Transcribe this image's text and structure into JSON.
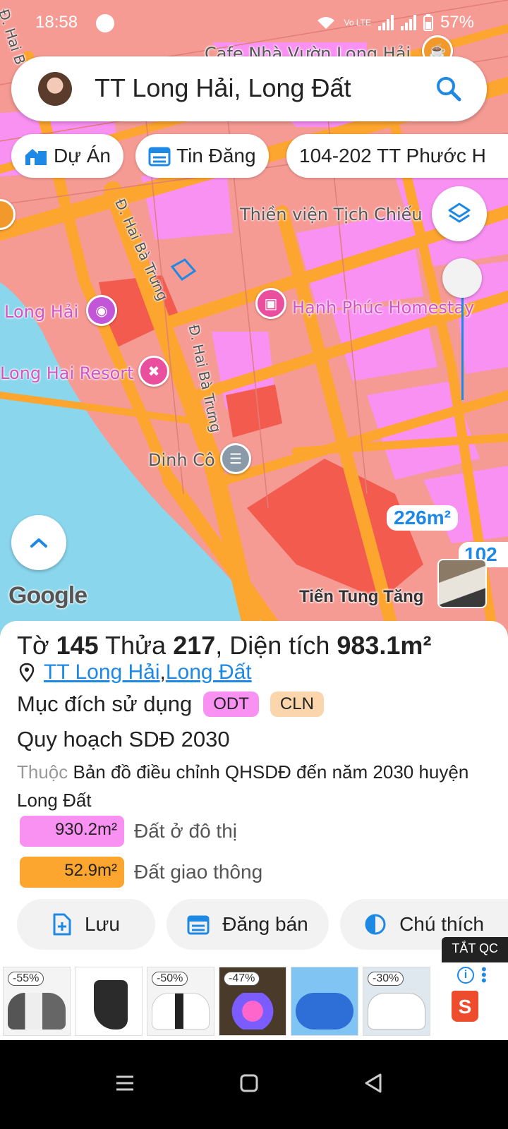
{
  "status_bar": {
    "time": "18:58",
    "network_label": "Vo LTE",
    "battery": "57%"
  },
  "search": {
    "query": "TT Long Hải, Long Đất"
  },
  "chips": [
    {
      "label": "Dự Án",
      "icon": "building-icon"
    },
    {
      "label": "Tin Đăng",
      "icon": "calendar-list-icon"
    },
    {
      "label": "104-202 TT Phước H",
      "icon": ""
    }
  ],
  "map": {
    "labels": {
      "cafe": "Cafe Nhà Vườn Long Hải",
      "hai_road_top": "Đ. Hai B",
      "thien_vien": "Thiền viện Tịch Chiếu",
      "road_1": "Đ. Hai Bà Trưng",
      "road_2": "Đ. Hai Bà Trưng",
      "long_hai": "Long Hải",
      "homestay": "Hạnh Phúc Homestay",
      "resort": "Long Hai Resort",
      "dinh_co": "Dinh Cô"
    },
    "area_badge": "226m²",
    "area_badge_2": "102",
    "google_logo": "Google",
    "streetview_label": "Tiến Tung Tăng",
    "colors": {
      "residential": "#f991f3",
      "perennial": "#f59b94",
      "road": "#fca52f",
      "water": "#8ad6ec",
      "parcel_red": "#f35b4f"
    }
  },
  "parcel": {
    "prefix_to": "Tờ ",
    "to_number": "145",
    "prefix_thua": " Thửa ",
    "thua_number": "217",
    "prefix_area": ", Diện tích ",
    "area": "983.1m²",
    "location_link_1": "TT Long Hải",
    "location_sep": ", ",
    "location_link_2": "Long Đất",
    "usage_label": "Mục đích sử dụng",
    "usage_tags": [
      "ODT",
      "CLN"
    ],
    "plan_title": "Quy hoạch SDĐ 2030",
    "plan_desc_prefix": "Thuộc",
    "plan_desc": " Bản đồ điều chỉnh QHSDĐ đến năm 2030 huyện Long Đất",
    "land_rows": [
      {
        "amount": "930.2m²",
        "label": "Đất ở đô thị",
        "color": "#f991f3"
      },
      {
        "amount": "52.9m²",
        "label": "Đất giao thông",
        "color": "#fca52f"
      }
    ]
  },
  "actions": {
    "save": "Lưu",
    "post_sale": "Đăng bán",
    "legend": "Chú thích"
  },
  "ad": {
    "close_label": "TẮT QC",
    "items": [
      {
        "discount": "-55%"
      },
      {
        "discount": ""
      },
      {
        "discount": "-50%"
      },
      {
        "discount": "-47%"
      },
      {
        "discount": ""
      },
      {
        "discount": "-30%"
      }
    ],
    "shop_letter": "S"
  }
}
